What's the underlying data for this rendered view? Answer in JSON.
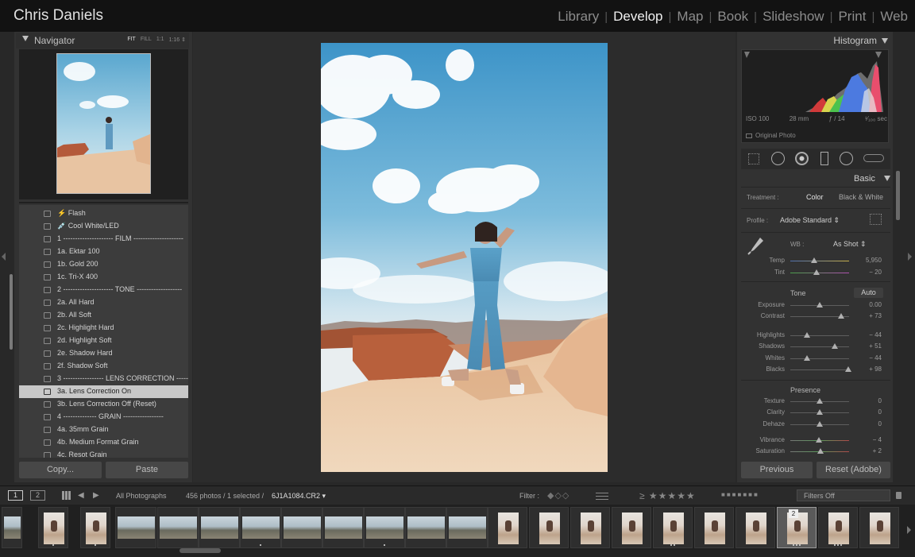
{
  "top_bar": {
    "identity_plate": "Chris Daniels",
    "modules": [
      {
        "label": "Library",
        "active": false
      },
      {
        "label": "Develop",
        "active": true
      },
      {
        "label": "Map",
        "active": false
      },
      {
        "label": "Book",
        "active": false
      },
      {
        "label": "Slideshow",
        "active": false
      },
      {
        "label": "Print",
        "active": false
      },
      {
        "label": "Web",
        "active": false
      }
    ],
    "separator": "|"
  },
  "navigator": {
    "title": "Navigator",
    "zoom_options": [
      "FIT",
      "FILL",
      "1:1",
      "1:16 ⇕"
    ],
    "selected_zoom": "FIT"
  },
  "presets": {
    "items": [
      {
        "label": "⚡ Flash",
        "selected": false
      },
      {
        "label": "💉 Cool White/LED",
        "selected": false
      },
      {
        "label": "1 --------------------- FILM ---------------------",
        "selected": false
      },
      {
        "label": "1a. Ektar 100",
        "selected": false
      },
      {
        "label": "1b. Gold 200",
        "selected": false
      },
      {
        "label": "1c. Tri-X 400",
        "selected": false
      },
      {
        "label": "2 --------------------- TONE -------------------",
        "selected": false
      },
      {
        "label": "2a. All Hard",
        "selected": false
      },
      {
        "label": "2b. All Soft",
        "selected": false
      },
      {
        "label": "2c. Highlight Hard",
        "selected": false
      },
      {
        "label": "2d. Highlight Soft",
        "selected": false
      },
      {
        "label": "2e. Shadow Hard",
        "selected": false
      },
      {
        "label": "2f. Shadow Soft",
        "selected": false
      },
      {
        "label": "3 ----------------- LENS CORRECTION ---------",
        "selected": false
      },
      {
        "label": "3a. Lens Correction On",
        "selected": true
      },
      {
        "label": "3b. Lens Correction Off (Reset)",
        "selected": false
      },
      {
        "label": "4 -------------- GRAIN -----------------",
        "selected": false
      },
      {
        "label": "4a. 35mm Grain",
        "selected": false
      },
      {
        "label": "4b. Medium Format Grain",
        "selected": false
      },
      {
        "label": "4c. Resot Grain",
        "selected": false
      }
    ]
  },
  "left_buttons": {
    "copy": "Copy...",
    "paste": "Paste"
  },
  "histogram": {
    "title": "Histogram",
    "iso": "ISO 100",
    "focal_length": "28 mm",
    "aperture": "ƒ / 14",
    "shutter": "¹⁄₁₀₀ sec",
    "original_photo": "Original Photo"
  },
  "basic": {
    "title": "Basic",
    "treatment_label": "Treatment :",
    "treatment_color": "Color",
    "treatment_bw": "Black & White",
    "profile_label": "Profile :",
    "profile_value": "Adobe Standard ⇕",
    "wb_label": "WB :",
    "wb_value": "As Shot ⇕",
    "tone_label": "Tone",
    "auto_label": "Auto",
    "presence_label": "Presence",
    "sliders": [
      {
        "label": "Temp",
        "value": "5,950",
        "pos": 0.4
      },
      {
        "label": "Tint",
        "value": "− 20",
        "pos": 0.45
      },
      {
        "label": "Exposure",
        "value": "0.00",
        "pos": 0.5
      },
      {
        "label": "Contrast",
        "value": "+ 73",
        "pos": 0.86
      },
      {
        "label": "Highlights",
        "value": "− 44",
        "pos": 0.28
      },
      {
        "label": "Shadows",
        "value": "+ 51",
        "pos": 0.75
      },
      {
        "label": "Whites",
        "value": "− 44",
        "pos": 0.28
      },
      {
        "label": "Blacks",
        "value": "+ 98",
        "pos": 0.99
      },
      {
        "label": "Texture",
        "value": "0",
        "pos": 0.5
      },
      {
        "label": "Clarity",
        "value": "0",
        "pos": 0.5
      },
      {
        "label": "Dehaze",
        "value": "0",
        "pos": 0.5
      },
      {
        "label": "Vibrance",
        "value": "− 4",
        "pos": 0.48
      },
      {
        "label": "Saturation",
        "value": "+ 2",
        "pos": 0.51
      }
    ]
  },
  "right_buttons": {
    "previous": "Previous",
    "reset": "Reset (Adobe)"
  },
  "filmstrip_bar": {
    "screen1": "1",
    "screen2": "2",
    "source": "All Photographs",
    "count": "456 photos / 1 selected /",
    "filename": "6J1A1084.CR2 ▾",
    "filter_label": "Filter :",
    "filters_off": "Filters Off"
  },
  "filmstrip": {
    "selected_badge": "2"
  },
  "colors": {
    "selected_preset_bg": "#c8c8c8",
    "panel_bg": "#323232",
    "top_bar_bg": "#121212"
  }
}
